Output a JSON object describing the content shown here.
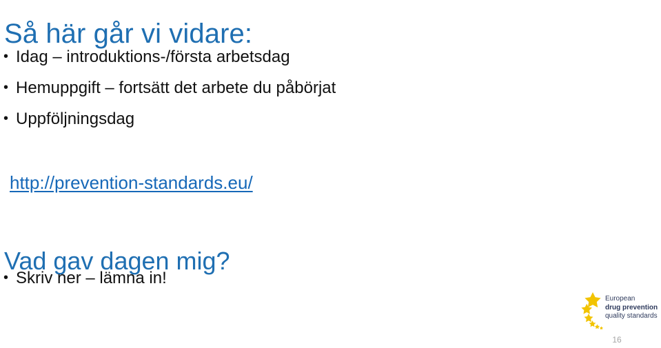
{
  "slide": {
    "title": "Så här går vi vidare:",
    "bullets_top": [
      "Idag – introduktions-/första arbetsdag",
      "Hemuppgift – fortsätt det arbete du påbörjat",
      "Uppföljningsdag"
    ],
    "link": {
      "text": "http://prevention-standards.eu/",
      "color": "#1668B8"
    },
    "sub_heading": "Vad gav dagen mig?",
    "bullets_bottom": [
      "Skriv ner – lämna in!"
    ],
    "bullet_marker": "•",
    "page_number": "16"
  },
  "logo": {
    "icon_name": "eu-stars-spiral-icon",
    "line1": "European",
    "line2": "drug prevention",
    "line3": "quality standards",
    "star_color": "#F2C300",
    "text_color": "#2E3A5C"
  },
  "colors": {
    "background": "#FFFFFF",
    "heading_blue": "#1F6FB2",
    "body_text": "#111111",
    "page_number_gray": "#A6A6A6"
  }
}
